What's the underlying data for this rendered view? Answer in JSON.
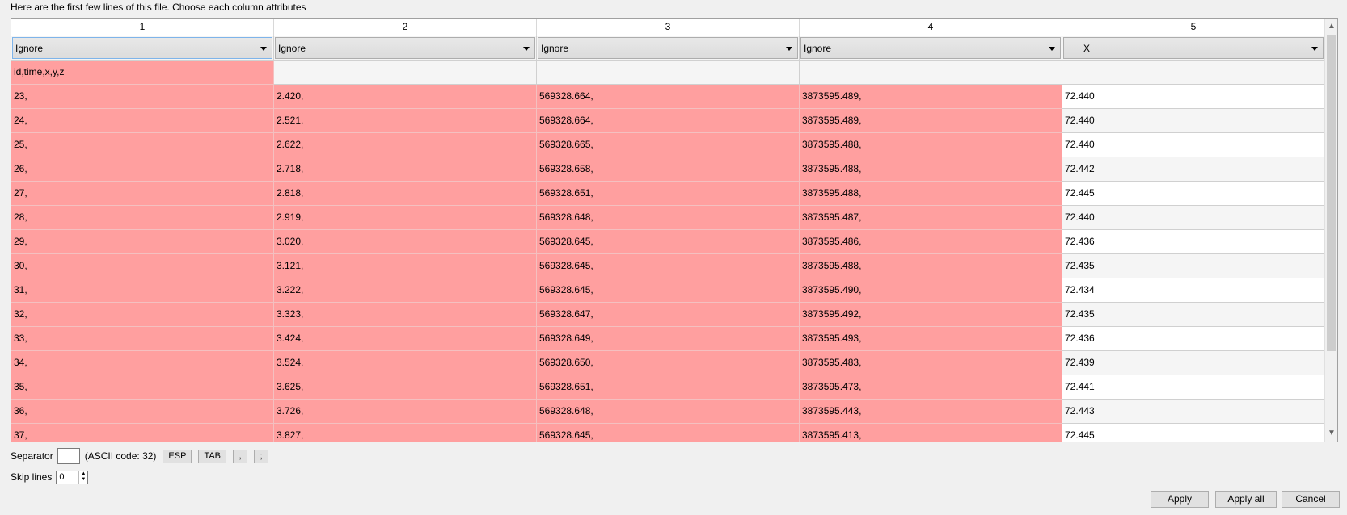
{
  "intro_text": "Here are the first few lines of this file. Choose each column attributes",
  "columns": [
    "1",
    "2",
    "3",
    "4",
    "5"
  ],
  "attributes": [
    "Ignore",
    "Ignore",
    "Ignore",
    "Ignore",
    "X"
  ],
  "header_line": "id,time,x,y,z",
  "rows": [
    [
      "23,",
      "2.420,",
      "569328.664,",
      "3873595.489,",
      "72.440"
    ],
    [
      "24,",
      "2.521,",
      "569328.664,",
      "3873595.489,",
      "72.440"
    ],
    [
      "25,",
      "2.622,",
      "569328.665,",
      "3873595.488,",
      "72.440"
    ],
    [
      "26,",
      "2.718,",
      "569328.658,",
      "3873595.488,",
      "72.442"
    ],
    [
      "27,",
      "2.818,",
      "569328.651,",
      "3873595.488,",
      "72.445"
    ],
    [
      "28,",
      "2.919,",
      "569328.648,",
      "3873595.487,",
      "72.440"
    ],
    [
      "29,",
      "3.020,",
      "569328.645,",
      "3873595.486,",
      "72.436"
    ],
    [
      "30,",
      "3.121,",
      "569328.645,",
      "3873595.488,",
      "72.435"
    ],
    [
      "31,",
      "3.222,",
      "569328.645,",
      "3873595.490,",
      "72.434"
    ],
    [
      "32,",
      "3.323,",
      "569328.647,",
      "3873595.492,",
      "72.435"
    ],
    [
      "33,",
      "3.424,",
      "569328.649,",
      "3873595.493,",
      "72.436"
    ],
    [
      "34,",
      "3.524,",
      "569328.650,",
      "3873595.483,",
      "72.439"
    ],
    [
      "35,",
      "3.625,",
      "569328.651,",
      "3873595.473,",
      "72.441"
    ],
    [
      "36,",
      "3.726,",
      "569328.648,",
      "3873595.443,",
      "72.443"
    ],
    [
      "37,",
      "3.827,",
      "569328.645,",
      "3873595.413,",
      "72.445"
    ]
  ],
  "separator": {
    "label": "Separator",
    "value": "",
    "ascii_text": "(ASCII code: 32)",
    "buttons": [
      "ESP",
      "TAB",
      ",",
      ";"
    ]
  },
  "skip_lines": {
    "label": "Skip lines",
    "value": "0"
  },
  "footer_buttons": {
    "apply": "Apply",
    "apply_all": "Apply all",
    "cancel": "Cancel"
  },
  "colors": {
    "ignored_cell": "#ff9f9f",
    "window_bg": "#f0f0f0"
  },
  "icons": {
    "dropdown": "chevron-down-icon",
    "scroll_up": "scroll-up-arrow-icon",
    "scroll_down": "scroll-down-arrow-icon",
    "spin": "spinner-arrows-icon"
  }
}
